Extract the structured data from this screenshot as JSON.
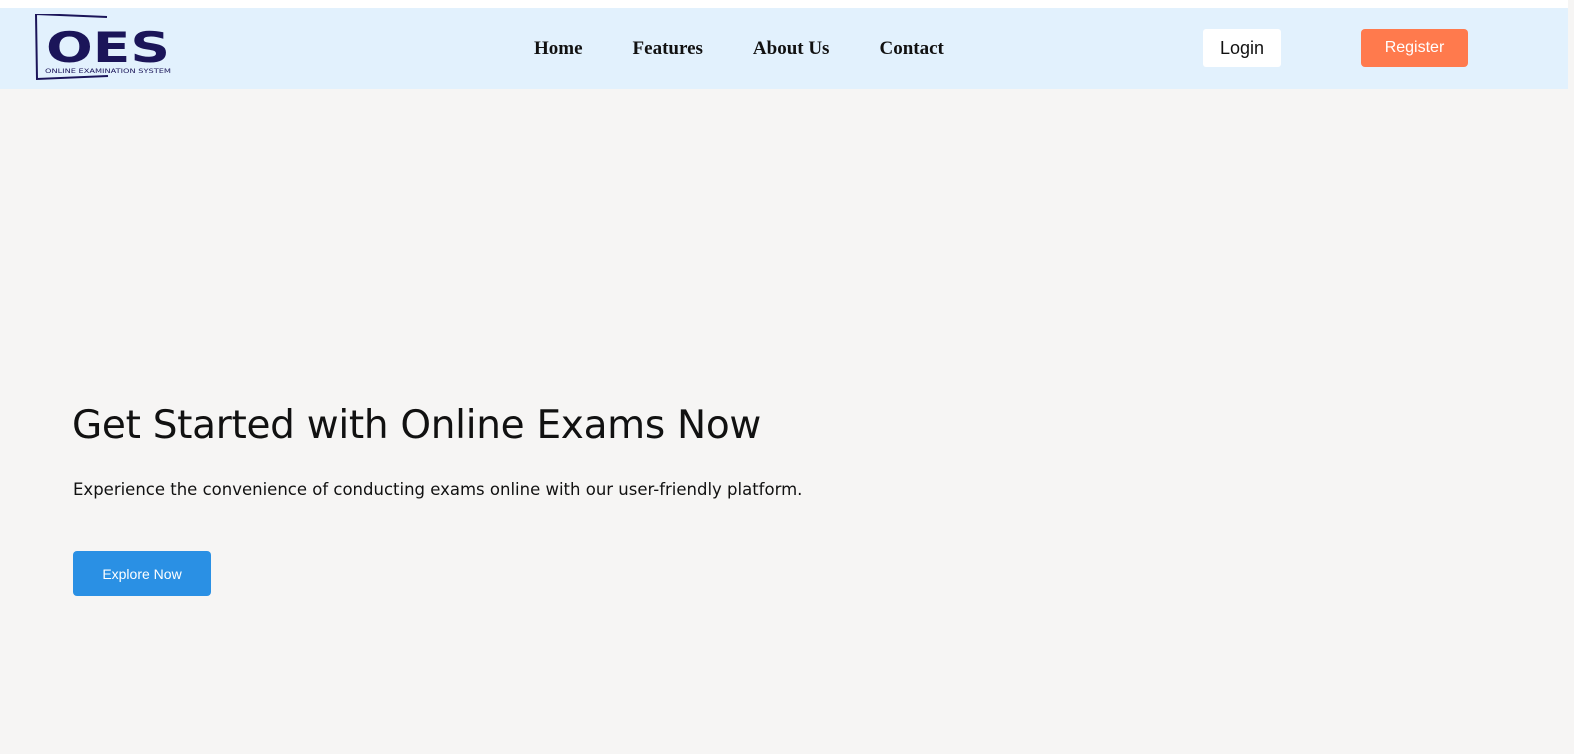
{
  "brand": {
    "logo_letters": "OES",
    "logo_tagline": "ONLINE EXAMINATION SYSTEM",
    "logo_color": "#1b1559"
  },
  "nav": {
    "links": [
      {
        "label": "Home"
      },
      {
        "label": "Features"
      },
      {
        "label": "About Us"
      },
      {
        "label": "Contact"
      }
    ],
    "login_label": "Login",
    "register_label": "Register"
  },
  "hero": {
    "title": "Get Started with Online Exams Now",
    "subtitle": "Experience the convenience of conducting exams online with our user-friendly platform.",
    "cta_label": "Explore Now"
  },
  "colors": {
    "navbar_bg": "#e2f1fd",
    "page_bg": "#f6f5f4",
    "register_bg": "#ff7a4d",
    "cta_bg": "#2a90e4"
  }
}
